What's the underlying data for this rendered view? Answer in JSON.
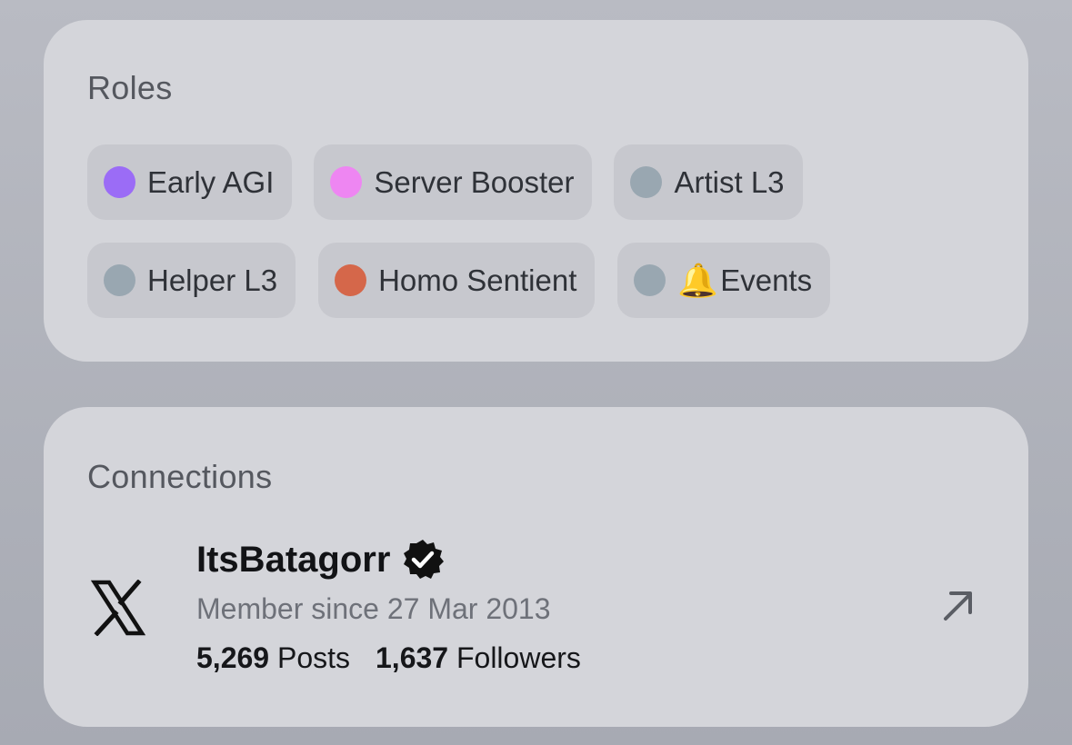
{
  "roles": {
    "title": "Roles",
    "items": [
      {
        "label": "Early AGI",
        "color": "#9b6cf6",
        "emoji": ""
      },
      {
        "label": "Server Booster",
        "color": "#ee86f2",
        "emoji": ""
      },
      {
        "label": "Artist L3",
        "color": "#99a7b1",
        "emoji": ""
      },
      {
        "label": "Helper L3",
        "color": "#99a7b1",
        "emoji": ""
      },
      {
        "label": "Homo Sentient",
        "color": "#d5674a",
        "emoji": ""
      },
      {
        "label": "Events",
        "color": "#99a7b1",
        "emoji": "🔔"
      }
    ]
  },
  "connections": {
    "title": "Connections",
    "account": {
      "platform_icon": "x-logo-icon",
      "name": "ItsBatagorr",
      "verified_icon": "verified-badge-icon",
      "member_since": "Member since 27 Mar 2013",
      "posts_count": "5,269",
      "posts_label": "Posts",
      "followers_count": "1,637",
      "followers_label": "Followers",
      "link_icon": "arrow-up-right-icon"
    }
  }
}
